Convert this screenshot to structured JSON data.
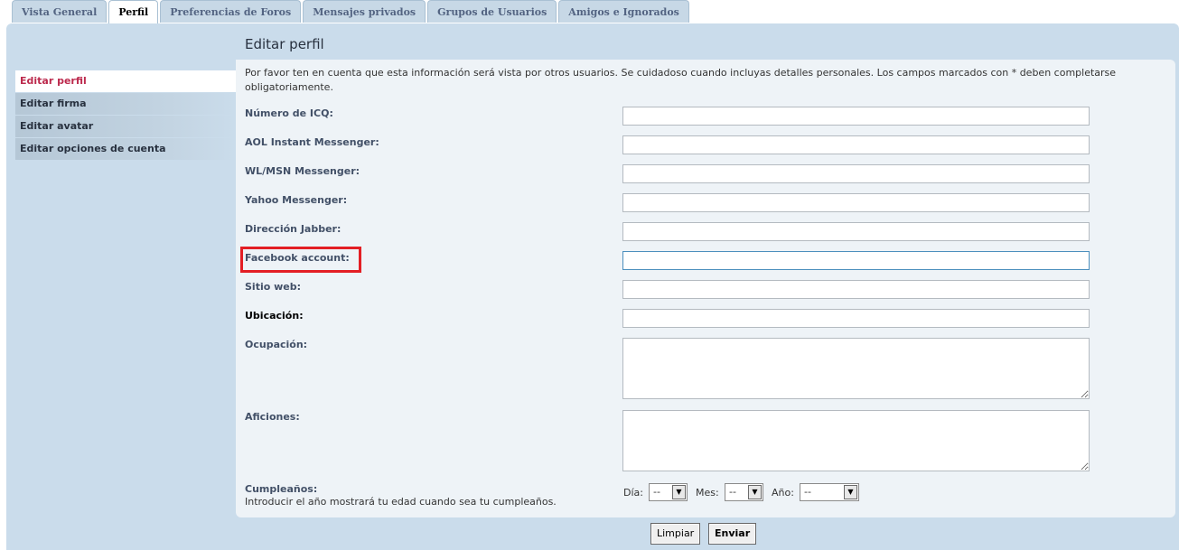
{
  "tabs": [
    "Vista General",
    "Perfil",
    "Preferencias de Foros",
    "Mensajes privados",
    "Grupos de Usuarios",
    "Amigos e Ignorados"
  ],
  "page_title": "Editar perfil",
  "sidebar": [
    "Editar perfil",
    "Editar firma",
    "Editar avatar",
    "Editar opciones de cuenta"
  ],
  "notice": "Por favor ten en cuenta que esta información será vista por otros usuarios. Se cuidadoso cuando incluyas detalles personales. Los campos marcados con * deben completarse obligatoriamente.",
  "fields": {
    "icq": "Número de ICQ:",
    "aol": "AOL Instant Messenger:",
    "msn": "WL/MSN Messenger:",
    "yahoo": "Yahoo Messenger:",
    "jabber": "Dirección Jabber:",
    "facebook": "Facebook account:",
    "website": "Sitio web:",
    "location": "Ubicación:",
    "occupation": "Ocupación:",
    "interests": "Aficiones:"
  },
  "birthday": {
    "label": "Cumpleaños:",
    "hint": "Introducir el año mostrará tu edad cuando sea tu cumpleaños.",
    "day_label": "Día:",
    "month_label": "Mes:",
    "year_label": "Año:",
    "day_value": "--",
    "month_value": "--",
    "year_value": "--"
  },
  "buttons": {
    "reset": "Limpiar",
    "submit": "Enviar"
  },
  "colors": {
    "panel_bg": "#cadceb",
    "content_bg": "#eef3f7",
    "active_link": "#bc2a4d",
    "highlight_box": "#e31e24"
  }
}
